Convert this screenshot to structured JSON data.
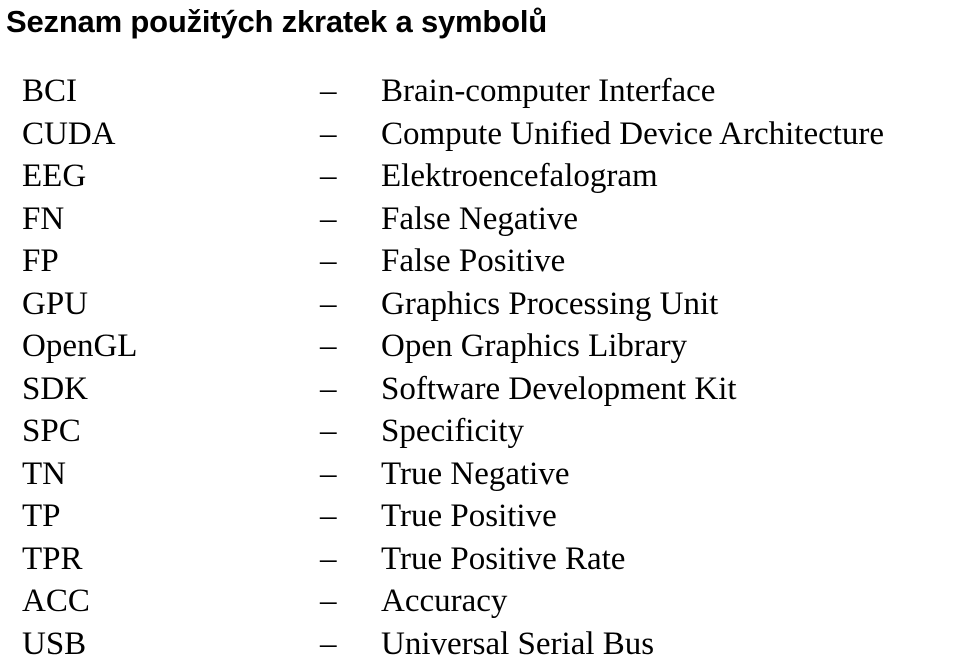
{
  "document": {
    "title": "Seznam použitých zkratek a symbolů",
    "separator": "–",
    "entries": [
      {
        "abbr": "BCI",
        "definition": "Brain-computer Interface"
      },
      {
        "abbr": "CUDA",
        "definition": "Compute Unified Device Architecture"
      },
      {
        "abbr": "EEG",
        "definition": "Elektroencefalogram"
      },
      {
        "abbr": "FN",
        "definition": "False Negative"
      },
      {
        "abbr": "FP",
        "definition": "False Positive"
      },
      {
        "abbr": "GPU",
        "definition": "Graphics Processing Unit"
      },
      {
        "abbr": "OpenGL",
        "definition": "Open Graphics Library"
      },
      {
        "abbr": "SDK",
        "definition": "Software Development Kit"
      },
      {
        "abbr": "SPC",
        "definition": "Specificity"
      },
      {
        "abbr": "TN",
        "definition": "True Negative"
      },
      {
        "abbr": "TP",
        "definition": "True Positive"
      },
      {
        "abbr": "TPR",
        "definition": "True Positive Rate"
      },
      {
        "abbr": "ACC",
        "definition": "Accuracy"
      },
      {
        "abbr": "USB",
        "definition": "Universal Serial Bus"
      }
    ]
  }
}
